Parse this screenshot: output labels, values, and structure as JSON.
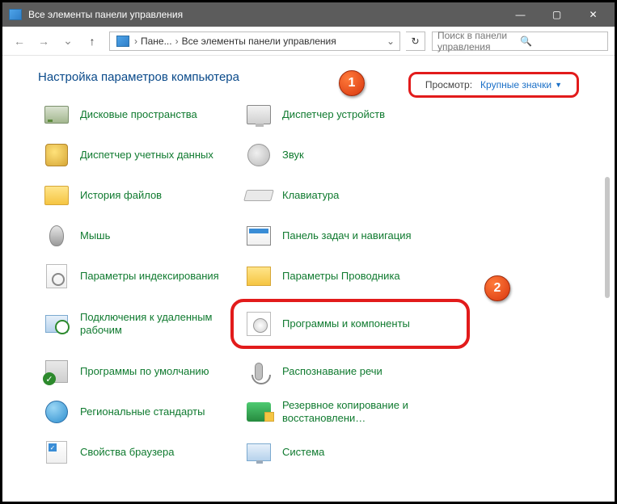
{
  "window": {
    "title": "Все элементы панели управления"
  },
  "nav": {
    "seg1": "Пане...",
    "seg2": "Все элементы панели управления",
    "search_placeholder": "Поиск в панели управления"
  },
  "heading": "Настройка параметров компьютера",
  "view": {
    "label": "Просмотр:",
    "value": "Крупные значки"
  },
  "items": {
    "disk_spaces": "Дисковые пространства",
    "device_manager": "Диспетчер устройств",
    "cred_manager": "Диспетчер учетных данных",
    "sound": "Звук",
    "file_history": "История файлов",
    "keyboard": "Клавиатура",
    "mouse": "Мышь",
    "taskbar_nav": "Панель задач и навигация",
    "indexing": "Параметры индексирования",
    "explorer_opts": "Параметры Проводника",
    "remote_desktop": "Подключения к удаленным рабочим",
    "programs_features": "Программы и компоненты",
    "default_programs": "Программы по умолчанию",
    "speech": "Распознавание речи",
    "region": "Региональные стандарты",
    "backup": "Резервное копирование и восстановлени…",
    "browser_props": "Свойства браузера",
    "system": "Система"
  },
  "callouts": {
    "one": "1",
    "two": "2"
  }
}
